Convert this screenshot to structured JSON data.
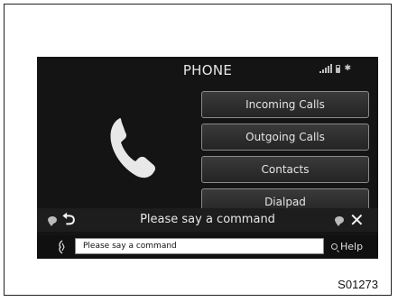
{
  "screen": {
    "title": "PHONE"
  },
  "menu": {
    "items": [
      {
        "label": "Incoming Calls"
      },
      {
        "label": "Outgoing Calls"
      },
      {
        "label": "Contacts"
      },
      {
        "label": "Dialpad"
      }
    ]
  },
  "voice_bar": {
    "prompt": "Please say a command"
  },
  "command_field": {
    "value": "Please say a command"
  },
  "help": {
    "label": "Help"
  },
  "figure": {
    "code": "S01273"
  },
  "icons": {
    "phone": "phone-handset-icon",
    "back": "back-arrow-icon",
    "close": "close-icon",
    "voice": "voice-command-icon",
    "speaker": "speaker-icon",
    "signal": "signal-strength-icon",
    "battery": "battery-icon",
    "bluetooth": "bluetooth-icon",
    "help": "search-icon"
  }
}
